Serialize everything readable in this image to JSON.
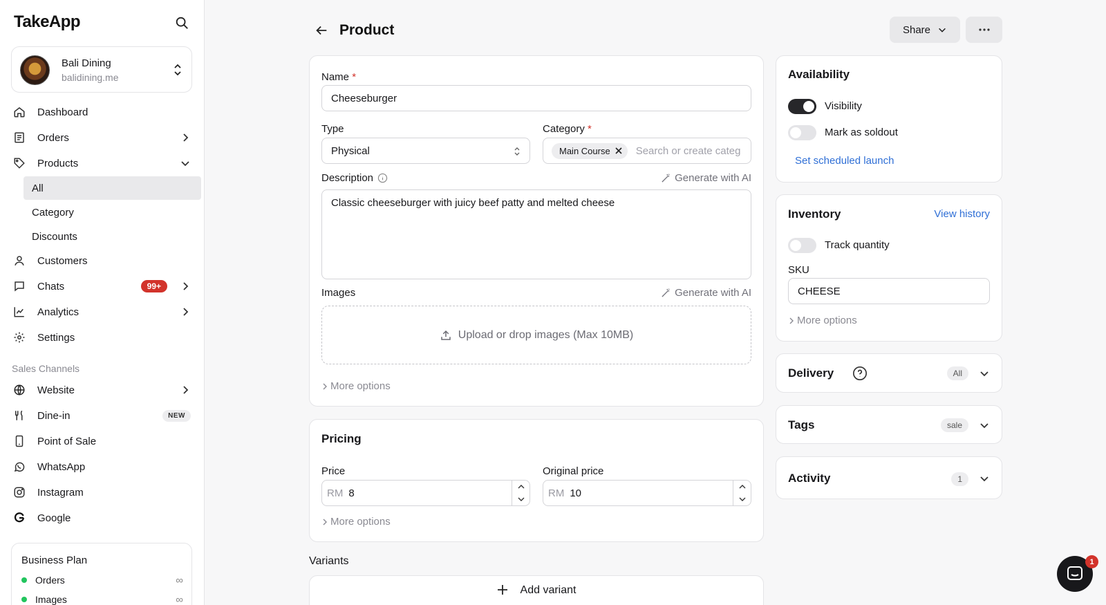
{
  "app": {
    "logo": "TakeApp"
  },
  "store": {
    "name": "Bali Dining",
    "url": "balidining.me"
  },
  "nav": {
    "dashboard": "Dashboard",
    "orders": "Orders",
    "products": "Products",
    "products_sub": [
      "All",
      "Category",
      "Discounts"
    ],
    "customers": "Customers",
    "chats": "Chats",
    "chats_badge": "99+",
    "analytics": "Analytics",
    "settings": "Settings"
  },
  "sales_channels": {
    "label": "Sales Channels",
    "website": "Website",
    "dinein": "Dine-in",
    "dinein_badge": "NEW",
    "pos": "Point of Sale",
    "whatsapp": "WhatsApp",
    "instagram": "Instagram",
    "google": "Google"
  },
  "plan": {
    "title": "Business Plan",
    "rows": [
      {
        "label": "Orders",
        "value": "∞"
      },
      {
        "label": "Images",
        "value": "∞"
      }
    ]
  },
  "header": {
    "title": "Product",
    "share": "Share"
  },
  "form": {
    "name_label": "Name",
    "name_value": "Cheeseburger",
    "type_label": "Type",
    "type_value": "Physical",
    "category_label": "Category",
    "category_chip": "Main Course",
    "category_placeholder": "Search or create categ",
    "description_label": "Description",
    "generate_ai": "Generate with AI",
    "description_value": "Classic cheeseburger with juicy beef patty and melted cheese",
    "images_label": "Images",
    "upload_text": "Upload or drop images (Max 10MB)",
    "more_options": "More options"
  },
  "pricing": {
    "title": "Pricing",
    "price_label": "Price",
    "price_currency": "RM",
    "price_value": "8",
    "original_label": "Original price",
    "original_currency": "RM",
    "original_value": "10",
    "more_options": "More options"
  },
  "variants": {
    "label": "Variants",
    "add": "Add variant"
  },
  "availability": {
    "title": "Availability",
    "visibility": "Visibility",
    "visibility_on": true,
    "soldout": "Mark as soldout",
    "soldout_on": false,
    "schedule": "Set scheduled launch"
  },
  "inventory": {
    "title": "Inventory",
    "view_history": "View history",
    "track": "Track quantity",
    "track_on": false,
    "sku_label": "SKU",
    "sku_value": "CHEESE",
    "more_options": "More options"
  },
  "delivery": {
    "title": "Delivery",
    "pill": "All"
  },
  "tags": {
    "title": "Tags",
    "pill": "sale"
  },
  "activity": {
    "title": "Activity",
    "pill": "1"
  },
  "chat_fab": {
    "badge": "1"
  }
}
